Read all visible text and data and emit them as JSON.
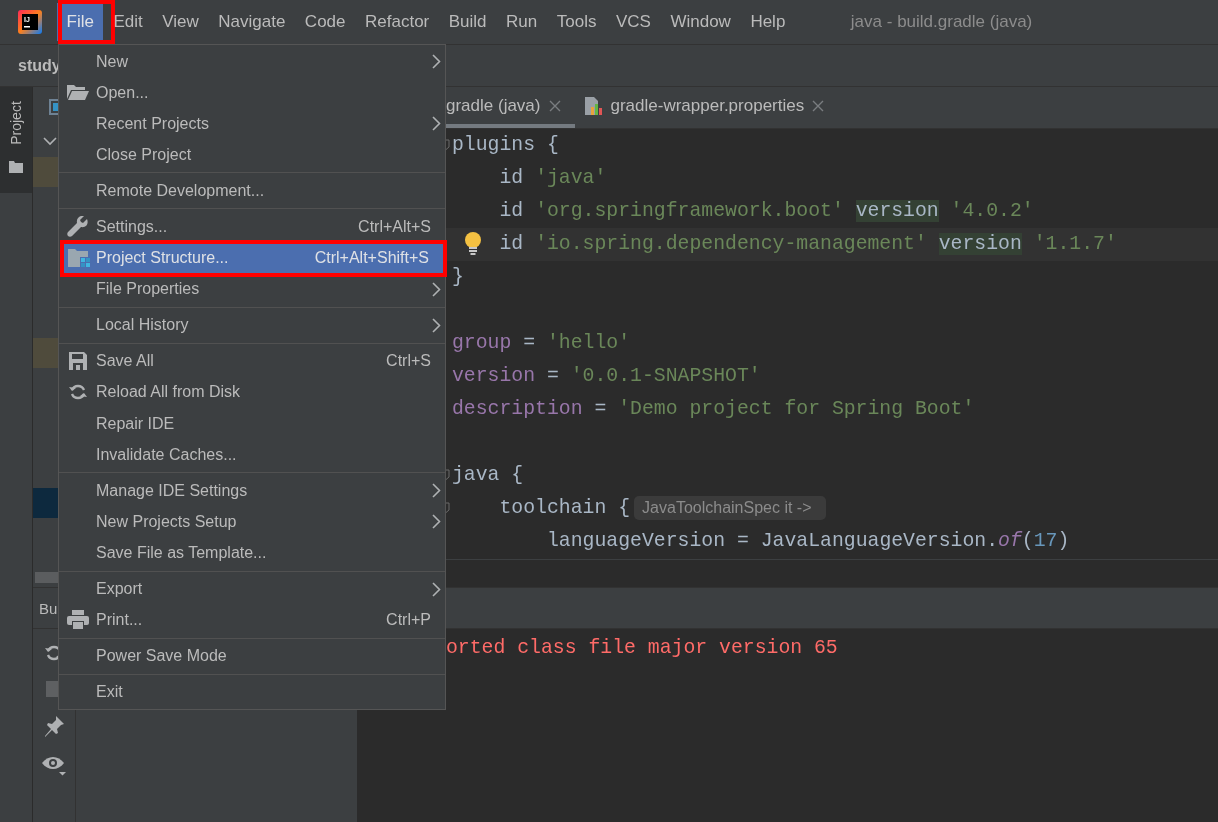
{
  "app": {
    "logo_text": "IJ"
  },
  "menubar": {
    "items": [
      {
        "label": "File",
        "selected": true,
        "annotated": true
      },
      {
        "label": "Edit",
        "selected": false,
        "annotated": false
      },
      {
        "label": "View",
        "selected": false,
        "annotated": false
      },
      {
        "label": "Navigate",
        "selected": false,
        "annotated": false
      },
      {
        "label": "Code",
        "selected": false,
        "annotated": false
      },
      {
        "label": "Refactor",
        "selected": false,
        "annotated": false
      },
      {
        "label": "Build",
        "selected": false,
        "annotated": false
      },
      {
        "label": "Run",
        "selected": false,
        "annotated": false
      },
      {
        "label": "Tools",
        "selected": false,
        "annotated": false
      },
      {
        "label": "VCS",
        "selected": false,
        "annotated": false
      },
      {
        "label": "Window",
        "selected": false,
        "annotated": false
      },
      {
        "label": "Help",
        "selected": false,
        "annotated": false
      }
    ],
    "title": "java - build.gradle (java)"
  },
  "navbar": {
    "project": "study"
  },
  "tool_stripe": {
    "tabs": [
      {
        "label": "Project",
        "selected": true
      }
    ]
  },
  "editor": {
    "tabs": [
      {
        "label": "gradle (java)",
        "selected": true,
        "kind": "none"
      },
      {
        "label": "gradle-wrapper.properties",
        "selected": false,
        "kind": "properties"
      }
    ],
    "lines": [
      {
        "kind": "code",
        "current": false,
        "tokens": [
          {
            "kind": "plain",
            "text": "plugins {"
          }
        ],
        "children": [
          {
            "kind": "code",
            "current": false,
            "tokens": [
              {
                "kind": "plain",
                "text": "id "
              },
              {
                "kind": "string",
                "text": "'java'"
              }
            ]
          },
          {
            "kind": "code",
            "current": false,
            "tokens": [
              {
                "kind": "plain",
                "text": "id "
              },
              {
                "kind": "string",
                "text": "'org.springframework.boot' "
              },
              {
                "kind": "marked",
                "text": "version"
              },
              {
                "kind": "string",
                "text": " '4.0.2'"
              }
            ]
          },
          {
            "kind": "code",
            "current": true,
            "tokens": [
              {
                "kind": "plain",
                "text": "id "
              },
              {
                "kind": "string",
                "text": "'io.spring.dependency-management' "
              },
              {
                "kind": "marked",
                "text": "version"
              },
              {
                "kind": "string",
                "text": " '1.1.7'"
              }
            ]
          }
        ]
      },
      {
        "kind": "code",
        "current": false,
        "tokens": [
          {
            "kind": "plain",
            "text": "}"
          }
        ]
      },
      {
        "kind": "blank"
      },
      {
        "kind": "code",
        "current": false,
        "tokens": [
          {
            "kind": "property",
            "text": "group"
          },
          {
            "kind": "plain",
            "text": " = "
          },
          {
            "kind": "string",
            "text": "'hello'"
          }
        ]
      },
      {
        "kind": "code",
        "current": false,
        "tokens": [
          {
            "kind": "property",
            "text": "version"
          },
          {
            "kind": "plain",
            "text": " = "
          },
          {
            "kind": "string",
            "text": "'0.0.1-SNAPSHOT'"
          }
        ]
      },
      {
        "kind": "code",
        "current": false,
        "tokens": [
          {
            "kind": "property",
            "text": "description"
          },
          {
            "kind": "plain",
            "text": " = "
          },
          {
            "kind": "string",
            "text": "'Demo project for Spring Boot'"
          }
        ]
      },
      {
        "kind": "blank"
      },
      {
        "kind": "code",
        "current": false,
        "tokens": [
          {
            "kind": "plain",
            "text": "java {"
          }
        ],
        "children": [
          {
            "kind": "code",
            "current": false,
            "tokens": [
              {
                "kind": "plain",
                "text": "toolchain {"
              },
              {
                "kind": "hint",
                "text": "JavaToolchainSpec it ->"
              }
            ],
            "children": [
              {
                "kind": "code",
                "current": false,
                "tokens": [
                  {
                    "kind": "plain",
                    "text": "languageVersion = JavaLanguageVersion."
                  },
                  {
                    "kind": "call",
                    "text": "of"
                  },
                  {
                    "kind": "plain",
                    "text": "("
                  },
                  {
                    "kind": "number",
                    "text": "17"
                  },
                  {
                    "kind": "plain",
                    "text": ")"
                  }
                ]
              }
            ]
          }
        ]
      }
    ]
  },
  "build_panel": {
    "title": "Bu",
    "console": "orted class file major version 65"
  },
  "file_menu": {
    "groups": [
      [
        {
          "label": "New",
          "kind": "plain",
          "submenu": true,
          "selected": false,
          "annotated": false
        },
        {
          "label": "Open...",
          "kind": "folder",
          "submenu": false,
          "selected": false,
          "annotated": false
        },
        {
          "label": "Recent Projects",
          "kind": "plain",
          "submenu": true,
          "selected": false,
          "annotated": false
        },
        {
          "label": "Close Project",
          "kind": "plain",
          "submenu": false,
          "selected": false,
          "annotated": false
        }
      ],
      [
        {
          "label": "Remote Development...",
          "kind": "plain",
          "submenu": false,
          "selected": false,
          "annotated": false
        }
      ],
      [
        {
          "label": "Settings...",
          "shortcut": "Ctrl+Alt+S",
          "kind": "wrench",
          "submenu": false,
          "selected": false,
          "annotated": false
        },
        {
          "label": "Project Structure...",
          "shortcut": "Ctrl+Alt+Shift+S",
          "kind": "structure",
          "submenu": false,
          "selected": true,
          "annotated": true
        },
        {
          "label": "File Properties",
          "kind": "plain",
          "submenu": true,
          "selected": false,
          "annotated": false
        }
      ],
      [
        {
          "label": "Local History",
          "kind": "plain",
          "submenu": true,
          "selected": false,
          "annotated": false
        }
      ],
      [
        {
          "label": "Save All",
          "shortcut": "Ctrl+S",
          "kind": "save",
          "submenu": false,
          "selected": false,
          "annotated": false
        },
        {
          "label": "Reload All from Disk",
          "kind": "reload",
          "submenu": false,
          "selected": false,
          "annotated": false
        },
        {
          "label": "Repair IDE",
          "kind": "plain",
          "submenu": false,
          "selected": false,
          "annotated": false
        },
        {
          "label": "Invalidate Caches...",
          "kind": "plain",
          "submenu": false,
          "selected": false,
          "annotated": false
        }
      ],
      [
        {
          "label": "Manage IDE Settings",
          "kind": "plain",
          "submenu": true,
          "selected": false,
          "annotated": false
        },
        {
          "label": "New Projects Setup",
          "kind": "plain",
          "submenu": true,
          "selected": false,
          "annotated": false
        },
        {
          "label": "Save File as Template...",
          "kind": "plain",
          "submenu": false,
          "selected": false,
          "annotated": false
        }
      ],
      [
        {
          "label": "Export",
          "kind": "plain",
          "submenu": true,
          "selected": false,
          "annotated": false
        },
        {
          "label": "Print...",
          "shortcut": "Ctrl+P",
          "kind": "print",
          "submenu": false,
          "selected": false,
          "annotated": false
        }
      ],
      [
        {
          "label": "Power Save Mode",
          "kind": "plain",
          "submenu": false,
          "selected": false,
          "annotated": false
        }
      ],
      [
        {
          "label": "Exit",
          "kind": "plain",
          "submenu": false,
          "selected": false,
          "annotated": false
        }
      ]
    ]
  }
}
